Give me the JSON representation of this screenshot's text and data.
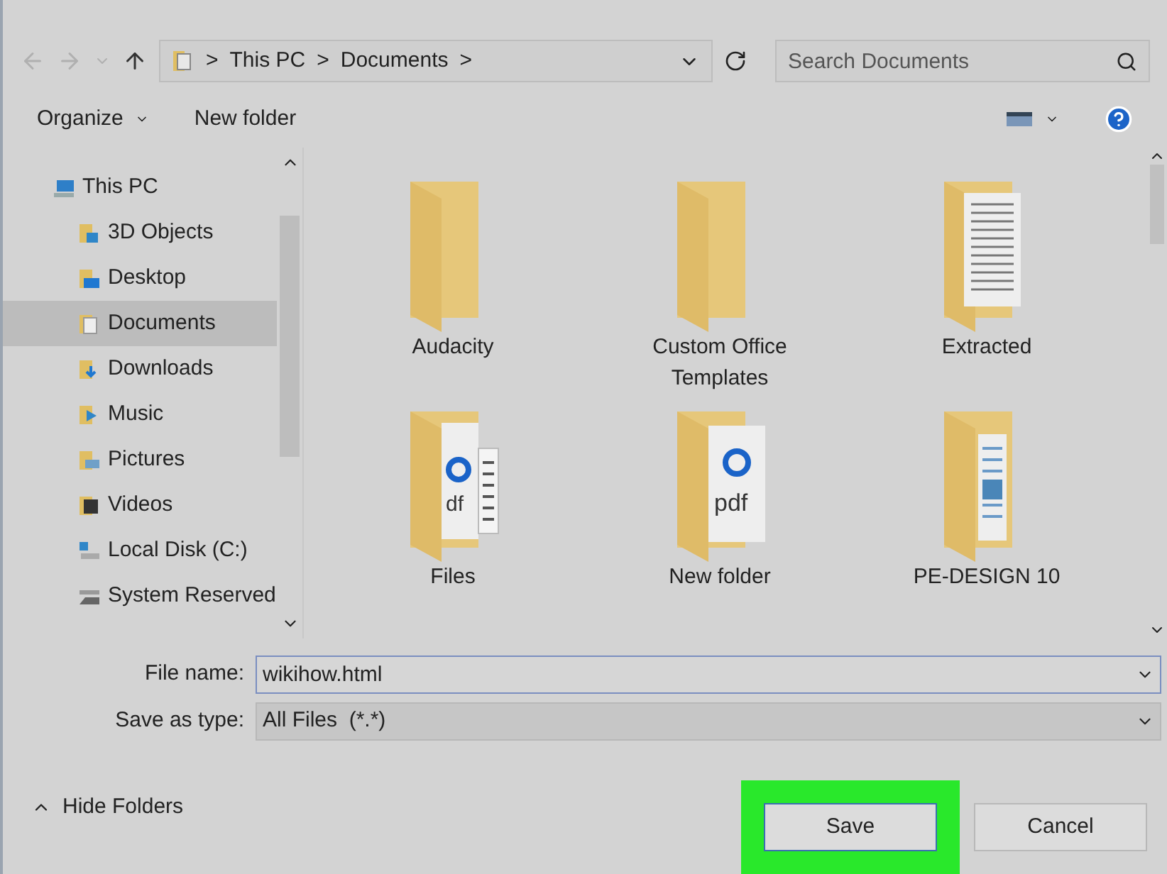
{
  "nav": {
    "breadcrumb": [
      "This PC",
      "Documents"
    ],
    "separator": ">",
    "search": {
      "placeholder": "Search Documents"
    }
  },
  "toolbar": {
    "items": [
      {
        "label": "Organize",
        "dropdown": true
      },
      {
        "label": "New folder",
        "dropdown": false
      }
    ]
  },
  "sidebar": {
    "items": [
      {
        "label": "This PC",
        "kind": "pc",
        "selected": false,
        "children": [
          {
            "label": "3D Objects",
            "kind": "objects",
            "selected": false
          },
          {
            "label": "Desktop",
            "kind": "desktop",
            "selected": false
          },
          {
            "label": "Documents",
            "kind": "documents",
            "selected": true
          },
          {
            "label": "Downloads",
            "kind": "downloads",
            "selected": false
          },
          {
            "label": "Music",
            "kind": "music",
            "selected": false
          },
          {
            "label": "Pictures",
            "kind": "pictures",
            "selected": false
          },
          {
            "label": "Videos",
            "kind": "videos",
            "selected": false
          },
          {
            "label": "Local Disk (C:)",
            "kind": "disk",
            "selected": false
          },
          {
            "label": "System Reserved",
            "kind": "drive",
            "selected": false
          }
        ]
      }
    ]
  },
  "files": [
    {
      "name": "Audacity",
      "kind": "empty"
    },
    {
      "name": "Custom Office Templates",
      "kind": "empty"
    },
    {
      "name": "Extracted",
      "kind": "papers"
    },
    {
      "name": "Files",
      "kind": "pdf-sheets",
      "thumbnail_text": "df"
    },
    {
      "name": "New folder",
      "kind": "pdf",
      "thumbnail_text": "pdf"
    },
    {
      "name": "PE-DESIGN 10",
      "kind": "sheets"
    }
  ],
  "form": {
    "file_name": {
      "label": "File name:",
      "value": "wikihow.html"
    },
    "save_as_type": {
      "label": "Save as type:",
      "value": "All Files  (*.*)"
    }
  },
  "footer": {
    "toggle": {
      "label": "Hide Folders",
      "expanded": true
    },
    "buttons": [
      {
        "label": "Save",
        "highlighted": true
      },
      {
        "label": "Cancel",
        "highlighted": false
      }
    ]
  }
}
